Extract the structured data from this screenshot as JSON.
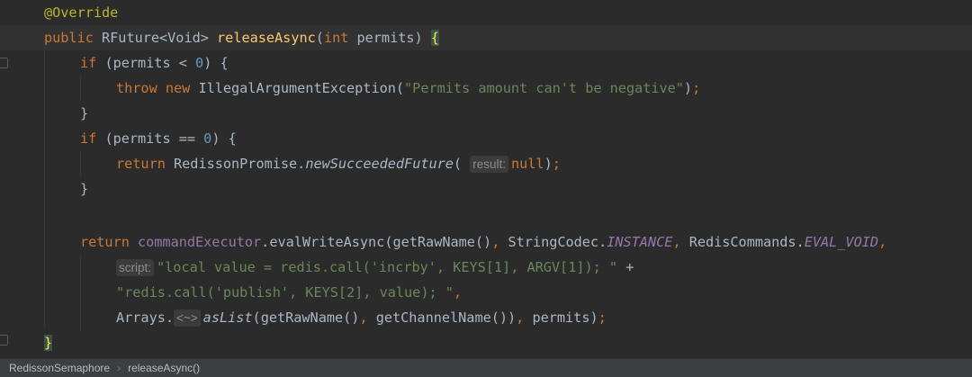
{
  "editor": {
    "current_line": 1,
    "lines": [
      {
        "indent": 0,
        "tokens": [
          [
            "ann",
            "@Override"
          ]
        ]
      },
      {
        "indent": 0,
        "tokens": [
          [
            "kw",
            "public "
          ],
          [
            "",
            "RFuture<Void> "
          ],
          [
            "decl",
            "releaseAsync"
          ],
          [
            "",
            "("
          ],
          [
            "kw",
            "int "
          ],
          [
            "",
            "permits) "
          ],
          [
            "brace",
            "{"
          ]
        ]
      },
      {
        "indent": 1,
        "tokens": [
          [
            "kw",
            "if "
          ],
          [
            "",
            "(permits < "
          ],
          [
            "num",
            "0"
          ],
          [
            "",
            ") {"
          ]
        ]
      },
      {
        "indent": 2,
        "tokens": [
          [
            "kw",
            "throw new "
          ],
          [
            "",
            "IllegalArgumentException("
          ],
          [
            "str",
            "\"Permits amount can't be negative\""
          ],
          [
            "",
            ")"
          ],
          [
            "punc",
            ";"
          ]
        ]
      },
      {
        "indent": 1,
        "tokens": [
          [
            "",
            "}"
          ]
        ]
      },
      {
        "indent": 1,
        "tokens": [
          [
            "kw",
            "if "
          ],
          [
            "",
            "(permits == "
          ],
          [
            "num",
            "0"
          ],
          [
            "",
            ") {"
          ]
        ]
      },
      {
        "indent": 2,
        "tokens": [
          [
            "kw",
            "return "
          ],
          [
            "",
            "RedissonPromise."
          ],
          [
            "it",
            "newSucceededFuture"
          ],
          [
            "",
            "( "
          ],
          [
            "hint",
            "result:"
          ],
          [
            "kw",
            "null"
          ],
          [
            "",
            ")"
          ],
          [
            "punc",
            ";"
          ]
        ]
      },
      {
        "indent": 1,
        "tokens": [
          [
            "",
            "}"
          ]
        ]
      },
      {
        "indent": 0,
        "tokens": []
      },
      {
        "indent": 1,
        "tokens": [
          [
            "kw",
            "return "
          ],
          [
            "fld",
            "commandExecutor"
          ],
          [
            "",
            ".evalWriteAsync(getRawName()"
          ],
          [
            "punc",
            ", "
          ],
          [
            "",
            "StringCodec."
          ],
          [
            "fldit",
            "INSTANCE"
          ],
          [
            "punc",
            ", "
          ],
          [
            "",
            "RedisCommands."
          ],
          [
            "fldit",
            "EVAL_VOID"
          ],
          [
            "punc",
            ","
          ]
        ]
      },
      {
        "indent": 2,
        "tokens": [
          [
            "hint",
            "script:"
          ],
          [
            "str",
            "\"local value = redis.call('incrby', KEYS[1], ARGV[1]); \""
          ],
          [
            "",
            " +"
          ]
        ]
      },
      {
        "indent": 2,
        "tokens": [
          [
            "str",
            "\"redis.call('publish', KEYS[2], value); \""
          ],
          [
            "punc",
            ","
          ]
        ]
      },
      {
        "indent": 2,
        "tokens": [
          [
            "",
            "Arrays."
          ],
          [
            "hint",
            "<~>"
          ],
          [
            "it",
            "asList"
          ],
          [
            "",
            "(getRawName()"
          ],
          [
            "punc",
            ", "
          ],
          [
            "",
            "getChannelName())"
          ],
          [
            "punc",
            ", "
          ],
          [
            "",
            "permits)"
          ],
          [
            "punc",
            ";"
          ]
        ]
      },
      {
        "indent": 0,
        "tokens": [
          [
            "brace",
            "}"
          ]
        ]
      }
    ]
  },
  "breadcrumb": {
    "class_name": "RedissonSemaphore",
    "method_name": "releaseAsync()"
  }
}
